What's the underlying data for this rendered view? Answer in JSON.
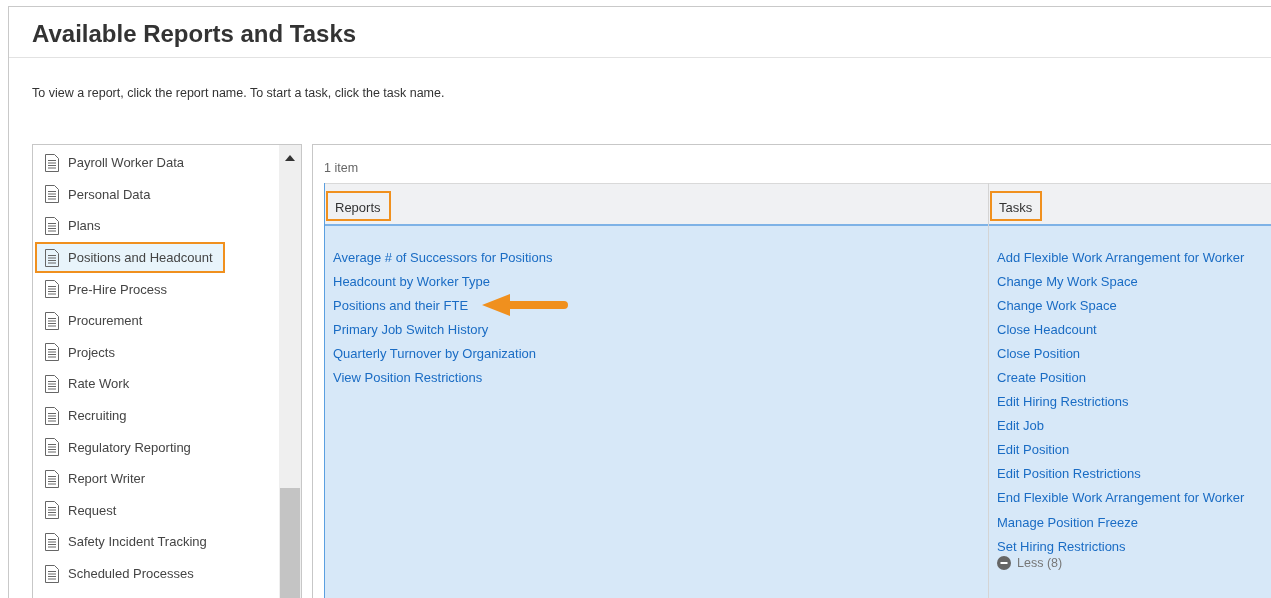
{
  "page": {
    "title": "Available Reports and Tasks",
    "instruction": "To view a report, click the report name. To start a task, click the task name."
  },
  "categories": [
    {
      "label": "Payroll Worker Data",
      "selected": false,
      "highlighted": false
    },
    {
      "label": "Personal Data",
      "selected": false,
      "highlighted": false
    },
    {
      "label": "Plans",
      "selected": false,
      "highlighted": false
    },
    {
      "label": "Positions and Headcount",
      "selected": true,
      "highlighted": true
    },
    {
      "label": "Pre-Hire Process",
      "selected": false,
      "highlighted": false
    },
    {
      "label": "Procurement",
      "selected": false,
      "highlighted": false
    },
    {
      "label": "Projects",
      "selected": false,
      "highlighted": false
    },
    {
      "label": "Rate Work",
      "selected": false,
      "highlighted": false
    },
    {
      "label": "Recruiting",
      "selected": false,
      "highlighted": false
    },
    {
      "label": "Regulatory Reporting",
      "selected": false,
      "highlighted": false
    },
    {
      "label": "Report Writer",
      "selected": false,
      "highlighted": false
    },
    {
      "label": "Request",
      "selected": false,
      "highlighted": false
    },
    {
      "label": "Safety Incident Tracking",
      "selected": false,
      "highlighted": false
    },
    {
      "label": "Scheduled Processes",
      "selected": false,
      "highlighted": false
    }
  ],
  "results": {
    "count": "1 item",
    "columns": [
      {
        "heading": "Reports",
        "highlighted": true,
        "links": [
          {
            "label": "Average # of Successors for Positions",
            "pointed": false
          },
          {
            "label": "Headcount by Worker Type",
            "pointed": false
          },
          {
            "label": "Positions and their FTE",
            "pointed": true
          },
          {
            "label": "Primary Job Switch History",
            "pointed": false
          },
          {
            "label": "Quarterly Turnover by Organization",
            "pointed": false
          },
          {
            "label": "View Position Restrictions",
            "pointed": false
          }
        ]
      },
      {
        "heading": "Tasks",
        "highlighted": true,
        "links": [
          {
            "label": "Add Flexible Work Arrangement for Worker",
            "pointed": false
          },
          {
            "label": "Change My Work Space",
            "pointed": false
          },
          {
            "label": "Change Work Space",
            "pointed": false
          },
          {
            "label": "Close Headcount",
            "pointed": false
          },
          {
            "label": "Close Position",
            "pointed": false
          },
          {
            "label": "Create Position",
            "pointed": false
          },
          {
            "label": "Edit Hiring Restrictions",
            "pointed": false
          },
          {
            "label": "Edit Job",
            "pointed": false
          },
          {
            "label": "Edit Position",
            "pointed": false
          },
          {
            "label": "Edit Position Restrictions",
            "pointed": false
          },
          {
            "label": "End Flexible Work Arrangement for Worker",
            "pointed": false
          },
          {
            "label": "Manage Position Freeze",
            "pointed": false
          },
          {
            "label": "Set Hiring Restrictions",
            "pointed": false
          }
        ],
        "toggle": "Less (8)"
      }
    ]
  }
}
